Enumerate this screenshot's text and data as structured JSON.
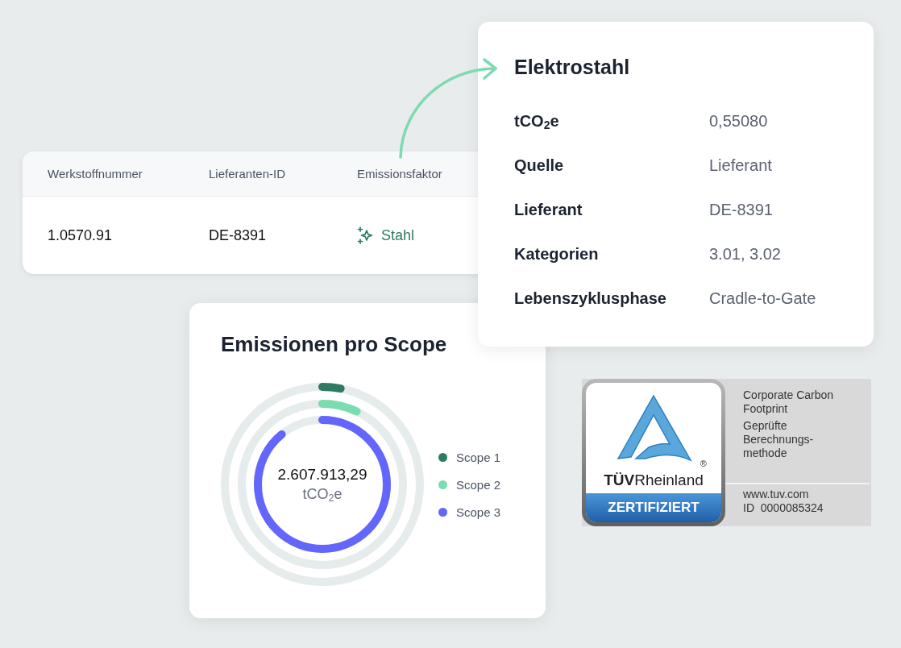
{
  "table": {
    "columns": [
      "Werkstoffnummer",
      "Lieferanten-ID",
      "Emissionsfaktor"
    ],
    "rows": [
      {
        "cells": [
          "1.0570.91",
          "DE-8391",
          "Stahl"
        ]
      }
    ]
  },
  "detail": {
    "title": "Elektrostahl",
    "fields": [
      {
        "label": "tCO$_{2}$e",
        "value": "0,55080"
      },
      {
        "label": "Quelle",
        "value": "Lieferant"
      },
      {
        "label": "Lieferant",
        "value": "DE-8391"
      },
      {
        "label": "Kategorien",
        "value": "3.01, 3.02"
      },
      {
        "label": "Lebenszyklusphase",
        "value": "Cradle-to-Gate"
      }
    ]
  },
  "scope_card": {
    "title": "Emissionen pro Scope",
    "total": "2.607.913,29",
    "unit": "tCO$_{2}$e",
    "scopes": [
      {
        "label": "Scope 1",
        "color": "#2f7a63",
        "level": 0.03
      },
      {
        "label": "Scope 2",
        "color": "#7adcb0",
        "level": 0.07
      },
      {
        "label": "Scope 3",
        "color": "#6366fa",
        "level": 0.89
      }
    ]
  },
  "certificate": {
    "brand_bold": "TÜV",
    "brand_rest": "Rheinland",
    "registered": "®",
    "badge": "ZERTIFIZIERT",
    "lines": [
      "Corporate Carbon Footprint",
      "Geprüfte Berechnungs-methode"
    ],
    "url": "www.tuv.com",
    "id": "ID  0000085324"
  }
}
